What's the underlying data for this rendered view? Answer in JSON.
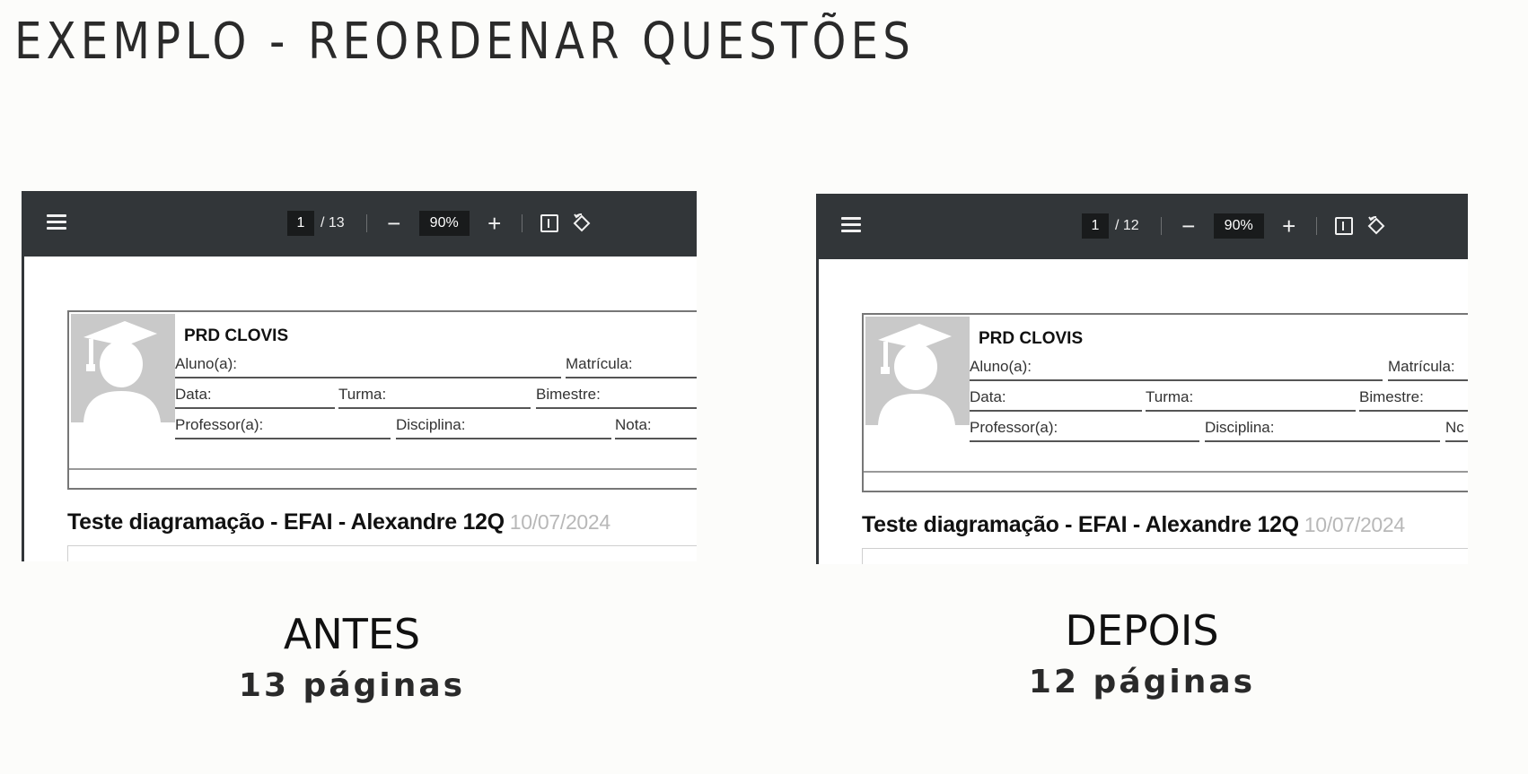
{
  "title": "EXEMPLO - REORDENAR QUESTÕES",
  "viewers": [
    {
      "toolbar": {
        "current_page": "1",
        "total_pages": "/ 13",
        "zoom": "90%",
        "zoom_out": "−",
        "zoom_in": "+"
      },
      "header": {
        "school": "PRD CLOVIS",
        "aluno": "Aluno(a):",
        "matricula": "Matrícula:",
        "data": "Data:",
        "turma": "Turma:",
        "bimestre": "Bimestre:",
        "professor": "Professor(a):",
        "disciplina": "Disciplina:",
        "nota": "Nota:"
      },
      "doc_title": "Teste diagramação - EFAI - Alexandre 12Q",
      "doc_date": "10/07/2024",
      "caption": "ANTES",
      "pages_text": "13 páginas"
    },
    {
      "toolbar": {
        "current_page": "1",
        "total_pages": "/ 12",
        "zoom": "90%",
        "zoom_out": "−",
        "zoom_in": "+"
      },
      "header": {
        "school": "PRD CLOVIS",
        "aluno": "Aluno(a):",
        "matricula": "Matrícula:",
        "data": "Data:",
        "turma": "Turma:",
        "bimestre": "Bimestre:",
        "professor": "Professor(a):",
        "disciplina": "Disciplina:",
        "nota": "Nc"
      },
      "doc_title": "Teste diagramação - EFAI - Alexandre 12Q",
      "doc_date": "10/07/2024",
      "caption": "DEPOIS",
      "pages_text": "12 páginas"
    }
  ]
}
